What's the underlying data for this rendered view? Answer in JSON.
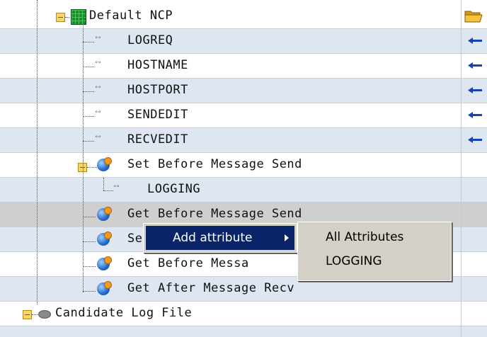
{
  "tree": {
    "rows": [
      {
        "label": "Default NCP"
      },
      {
        "label": "LOGREQ"
      },
      {
        "label": "HOSTNAME"
      },
      {
        "label": "HOSTPORT"
      },
      {
        "label": "SENDEDIT"
      },
      {
        "label": "RECVEDIT"
      },
      {
        "label": "Set Before Message Send"
      },
      {
        "label": "LOGGING"
      },
      {
        "label": "Get Before Message Send"
      },
      {
        "label": "Se"
      },
      {
        "label": "Get Before Messa"
      },
      {
        "label": "Get After Message Recv"
      },
      {
        "label": "Candidate Log File"
      }
    ]
  },
  "context_menu": {
    "item": "Add attribute"
  },
  "submenu": {
    "items": [
      "All Attributes",
      "LOGGING"
    ]
  },
  "icons": {
    "attr_glyph": "°°",
    "ncp": "network-grid-icon",
    "method": "globe-pencil-icon",
    "disk": "disk-icon",
    "arrow": "left-arrow-icon",
    "folder": "open-folder-icon"
  },
  "colors": {
    "row_blue": "#dde6f1",
    "row_selected": "#cfcfcf",
    "menu_highlight": "#0a246a",
    "menu_bg": "#d4d0c8"
  }
}
